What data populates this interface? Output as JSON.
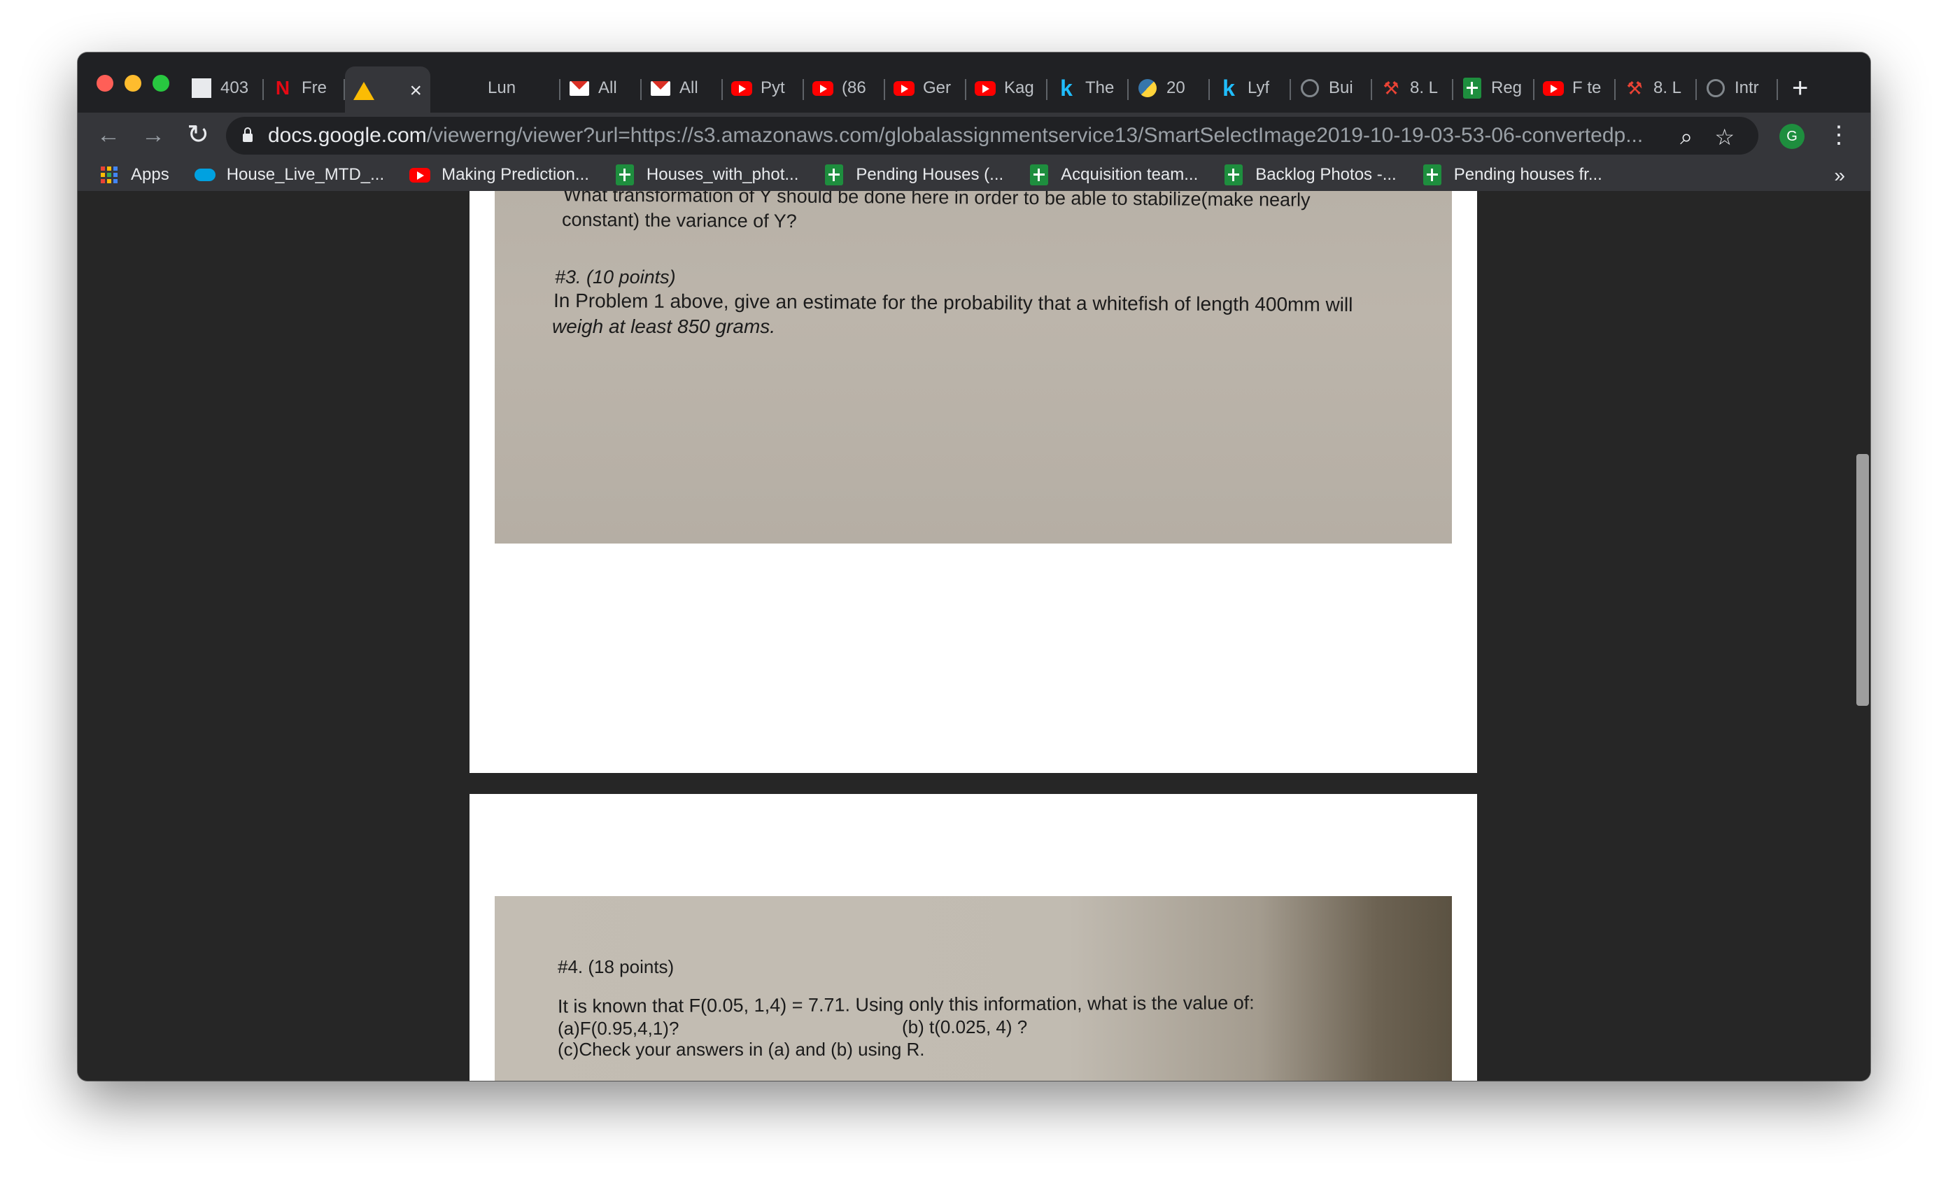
{
  "tabs": [
    {
      "title": "403",
      "icon": "calculator-icon"
    },
    {
      "title": "Fre",
      "icon": "netflix-icon"
    },
    {
      "title": "",
      "icon": "google-drive-icon",
      "active": true
    },
    {
      "title": "Lun",
      "icon": "none"
    },
    {
      "title": "All",
      "icon": "gmail-icon"
    },
    {
      "title": "All",
      "icon": "gmail-icon"
    },
    {
      "title": "Pyt",
      "icon": "youtube-icon"
    },
    {
      "title": "(86",
      "icon": "youtube-icon"
    },
    {
      "title": "Ger",
      "icon": "youtube-icon"
    },
    {
      "title": "Kag",
      "icon": "youtube-icon"
    },
    {
      "title": "The",
      "icon": "kaggle-icon"
    },
    {
      "title": "20",
      "icon": "python-icon"
    },
    {
      "title": "Lyf",
      "icon": "kaggle-icon"
    },
    {
      "title": "Bui",
      "icon": "globe-icon"
    },
    {
      "title": "8. L",
      "icon": "hammer-icon"
    },
    {
      "title": "Reg",
      "icon": "sheets-icon"
    },
    {
      "title": "F te",
      "icon": "youtube-icon"
    },
    {
      "title": "8. L",
      "icon": "hammer-icon"
    },
    {
      "title": "Intr",
      "icon": "globe-icon"
    }
  ],
  "toolbar": {
    "url_host": "docs.google.com",
    "url_path": "/viewerng/viewer?url=https://s3.amazonaws.com/globalassignmentservice13/SmartSelectImage2019-10-19-03-53-06-convertedp...",
    "avatar_letter": "G"
  },
  "bookmarks": [
    {
      "label": "Apps",
      "icon": "apps-grid-icon"
    },
    {
      "label": "House_Live_MTD_...",
      "icon": "salesforce-icon"
    },
    {
      "label": "Making Prediction...",
      "icon": "youtube-icon"
    },
    {
      "label": "Houses_with_phot...",
      "icon": "sheets-icon"
    },
    {
      "label": "Pending Houses (...",
      "icon": "sheets-icon"
    },
    {
      "label": "Acquisition team...",
      "icon": "sheets-icon"
    },
    {
      "label": "Backlog Photos -...",
      "icon": "sheets-icon"
    },
    {
      "label": "Pending houses fr...",
      "icon": "sheets-icon"
    }
  ],
  "document": {
    "page1": {
      "q2_line1": "What transformation of Y should be done here in order to be able to stabilize(make nearly",
      "q2_line2": "constant) the variance of Y?",
      "q3_heading": "#3. (10 points)",
      "q3_line1": "In Problem 1 above, give an estimate for the probability that a whitefish of length 400mm will",
      "q3_line2": "weigh at least 850 grams."
    },
    "page2": {
      "q4_heading": "#4.  (18  points)",
      "q4_line1": "It is known that F(0.05, 1,4) = 7.71. Using only this information, what is the value of:",
      "q4_a": "(a)F(0.95,4,1)?",
      "q4_b": "(b) t(0.025, 4) ?",
      "q4_c": "(c)Check your answers in (a) and (b) using R."
    }
  }
}
